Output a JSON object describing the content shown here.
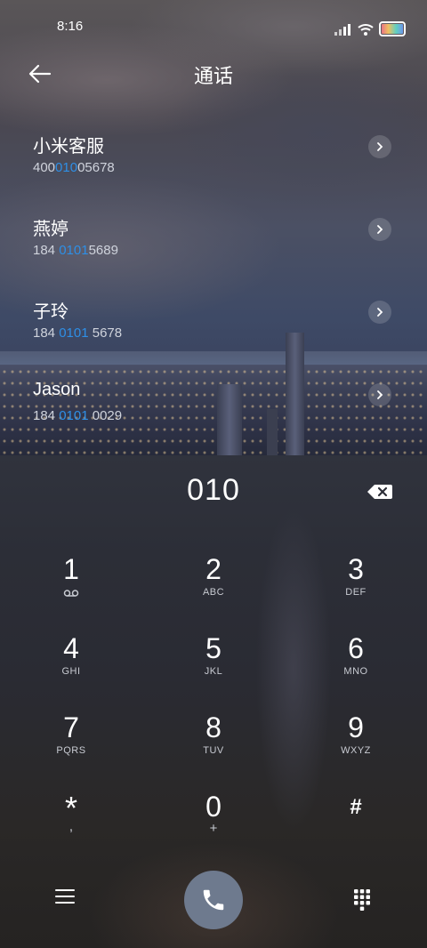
{
  "status_bar": {
    "time": "8:16",
    "icons": [
      "signal-icon",
      "wifi-icon",
      "battery-icon"
    ]
  },
  "header": {
    "back_icon": "back-arrow-icon",
    "title": "通话"
  },
  "contacts": [
    {
      "name": "小米客服",
      "number_before": "400",
      "number_match": "010",
      "number_after": "05678"
    },
    {
      "name": "燕婷",
      "number_before": "184 ",
      "number_match": "0101",
      "number_after": "5689"
    },
    {
      "name": "子玲",
      "number_before": "184 ",
      "number_match": "0101",
      "number_after": " 5678"
    },
    {
      "name": "Jason",
      "number_before": "184 ",
      "number_match": "0101",
      "number_after": " 0029"
    }
  ],
  "dialer": {
    "input_value": "010",
    "backspace_icon": "backspace-icon"
  },
  "keypad": [
    {
      "digit": "1",
      "letters": "",
      "icon": "voicemail-icon"
    },
    {
      "digit": "2",
      "letters": "ABC"
    },
    {
      "digit": "3",
      "letters": "DEF"
    },
    {
      "digit": "4",
      "letters": "GHI"
    },
    {
      "digit": "5",
      "letters": "JKL"
    },
    {
      "digit": "6",
      "letters": "MNO"
    },
    {
      "digit": "7",
      "letters": "PQRS"
    },
    {
      "digit": "8",
      "letters": "TUV"
    },
    {
      "digit": "9",
      "letters": "WXYZ"
    },
    {
      "digit": "*",
      "letters": ","
    },
    {
      "digit": "0",
      "letters": "+"
    },
    {
      "digit": "#",
      "letters": ""
    }
  ],
  "bottom_bar": {
    "menu_icon": "menu-icon",
    "call_icon": "phone-icon",
    "keypad_icon": "dialpad-icon"
  },
  "colors": {
    "match_highlight": "#2e8fe6",
    "call_button": "#6e7a8e"
  }
}
